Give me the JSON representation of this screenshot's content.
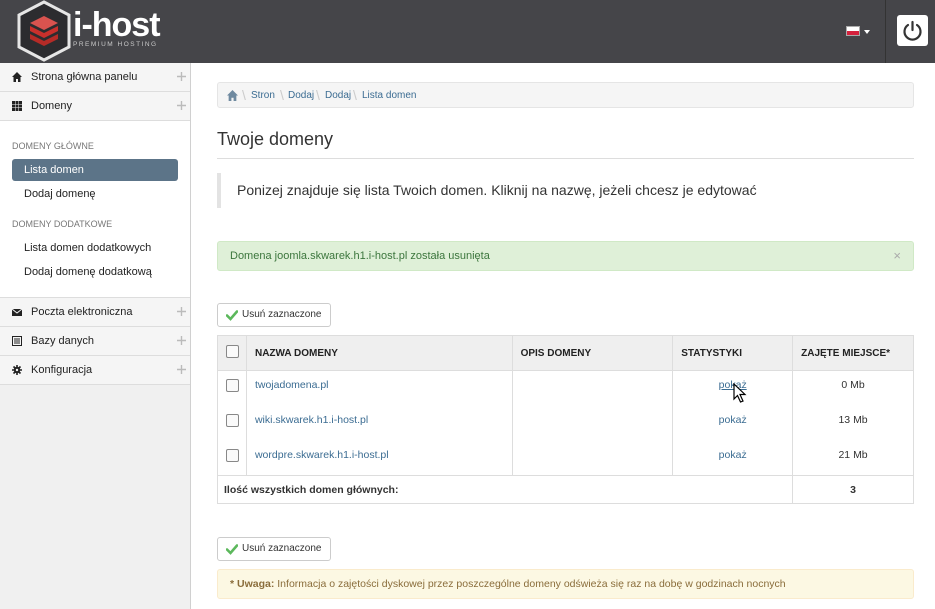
{
  "header": {
    "logo_text": "i-host",
    "logo_sub": "PREMIUM HOSTING",
    "language": "pl",
    "power_icon": "power-icon"
  },
  "sidebar": {
    "main_items": [
      {
        "label": "Strona główna panelu",
        "icon": "home-icon"
      },
      {
        "label": "Domeny",
        "icon": "grid-icon"
      },
      {
        "label": "Poczta elektroniczna",
        "icon": "envelope-icon"
      },
      {
        "label": "Bazy danych",
        "icon": "list-icon"
      },
      {
        "label": "Konfiguracja",
        "icon": "gear-icon"
      }
    ],
    "domeny_glowne_head": "DOMENY GŁÓWNE",
    "domeny_glowne_items": [
      "Lista domen",
      "Dodaj domenę"
    ],
    "domeny_dodatkowe_head": "DOMENY DODATKOWE",
    "domeny_dodatkowe_items": [
      "Lista domen dodatkowych",
      "Dodaj domenę dodatkową"
    ]
  },
  "breadcrumb": [
    "Stron",
    "Dodaj",
    "Dodaj",
    "Lista domen"
  ],
  "page_title": "Twoje domeny",
  "intro": "Ponizej znajduje się lista Twoich domen. Kliknij na nazwę, jeżeli chcesz je edytować",
  "success_alert": "Domena joomla.skwarek.h1.i-host.pl została usunięta",
  "delete_button": "Usuń zaznaczone",
  "table": {
    "headers": [
      "NAZWA DOMENY",
      "OPIS DOMENY",
      "STATYSTYKI",
      "ZAJĘTE MIEJSCE*"
    ],
    "rows": [
      {
        "name": "twojadomena.pl",
        "desc": "",
        "stats": "pokaż",
        "size": "0 Mb"
      },
      {
        "name": "wiki.skwarek.h1.i-host.pl",
        "desc": "",
        "stats": "pokaż",
        "size": "13 Mb"
      },
      {
        "name": "wordpre.skwarek.h1.i-host.pl",
        "desc": "",
        "stats": "pokaż",
        "size": "21 Mb"
      }
    ],
    "footer_label": "Ilość wszystkich domen głównych:",
    "footer_count": "3"
  },
  "warning": {
    "prefix": "* Uwaga:",
    "text": "Informacja o zajętości dyskowej przez poszczególne domeny odświeża się raz na dobę w godzinach nocnych"
  },
  "colors": {
    "header_bg": "#454549",
    "active_nav": "#5c7488",
    "link": "#3b6c92",
    "logo_red": "#c9302c"
  }
}
